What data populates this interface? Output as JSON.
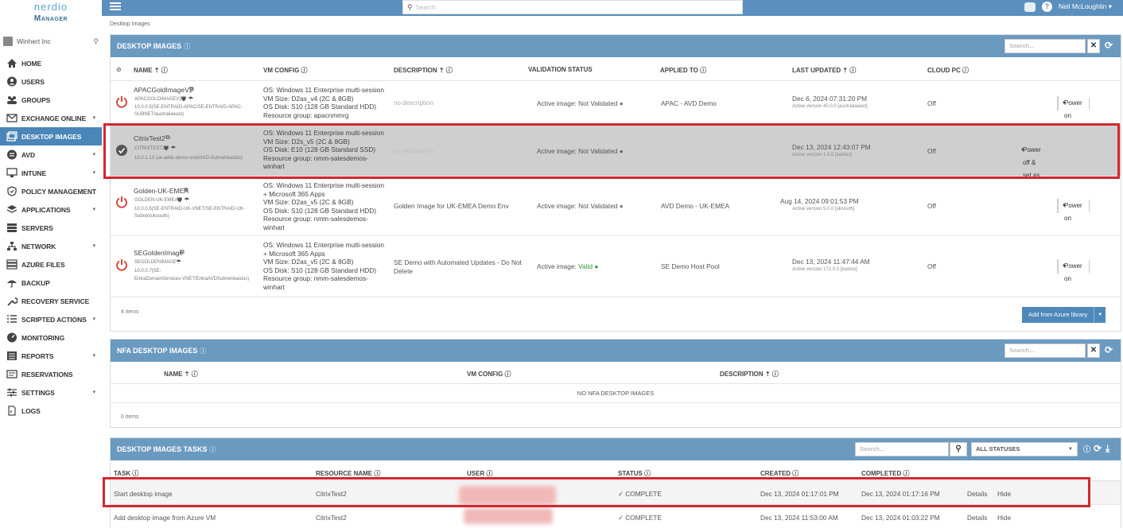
{
  "brand": {
    "logo_top": "nerdio",
    "logo_bottom": "Manager"
  },
  "org": {
    "name": "Winhert Inc"
  },
  "nav": [
    {
      "label": "HOME",
      "icon": "home-icon"
    },
    {
      "label": "USERS",
      "icon": "user-icon"
    },
    {
      "label": "GROUPS",
      "icon": "groups-icon"
    },
    {
      "label": "EXCHANGE ONLINE",
      "icon": "mail-icon",
      "chev": "▾"
    },
    {
      "label": "DESKTOP IMAGES",
      "icon": "desktop-icon",
      "active": true
    },
    {
      "label": "AVD",
      "icon": "avd-icon",
      "chev": "▾"
    },
    {
      "label": "INTUNE",
      "icon": "intune-icon",
      "chev": "▾"
    },
    {
      "label": "POLICY MANAGEMENT",
      "icon": "shield-icon",
      "chev": "▾"
    },
    {
      "label": "APPLICATIONS",
      "icon": "applications-icon",
      "chev": "▾"
    },
    {
      "label": "SERVERS",
      "icon": "servers-icon"
    },
    {
      "label": "NETWORK",
      "icon": "network-icon",
      "chev": "▾"
    },
    {
      "label": "AZURE FILES",
      "icon": "files-icon"
    },
    {
      "label": "BACKUP",
      "icon": "backup-icon"
    },
    {
      "label": "RECOVERY SERVICE",
      "icon": "wrench-icon"
    },
    {
      "label": "SCRIPTED ACTIONS",
      "icon": "script-icon",
      "chev": "▾"
    },
    {
      "label": "MONITORING",
      "icon": "monitoring-icon"
    },
    {
      "label": "REPORTS",
      "icon": "reports-icon",
      "chev": "▾"
    },
    {
      "label": "RESERVATIONS",
      "icon": "reservations-icon"
    },
    {
      "label": "SETTINGS",
      "icon": "settings-icon",
      "chev": "▾"
    },
    {
      "label": "LOGS",
      "icon": "logs-icon"
    }
  ],
  "topbar": {
    "search_placeholder": "Search",
    "user_name": "Neil McLoughlin ▾"
  },
  "breadcrumb": "Desktop Images",
  "desktop_images": {
    "title": "DESKTOP IMAGES",
    "search_placeholder": "Search...",
    "columns": {
      "name": "NAME ⇡ ⓘ",
      "vm": "VM CONFIG ⓘ",
      "desc": "DESCRIPTION ⇡ ⓘ",
      "valid": "VALIDATION STATUS",
      "applied": "APPLIED TO ⓘ",
      "updated": "LAST UPDATED ⇡ ⓘ",
      "cloud": "CLOUD PC ⓘ"
    },
    "rows": [
      {
        "name": "APACGoldImageV2",
        "sub1": "APACGOLDIMAGEV2",
        "sub2": "10.0.0.5(SE-ENTRAID-APAC/SE-ENTRAID-APAC-",
        "sub3": "SUBNET/australiaeast)",
        "vm": [
          "OS: Windows 11 Enterprise multi-session",
          "VM Size: D2as_v4 (2C & 8GB)",
          "OS Disk: S10 (128 GB Standard HDD)",
          "Resource group: apacnmmrg"
        ],
        "desc": "no description",
        "valid": "Active image: Not Validated",
        "applied": "APAC - AVD Demo",
        "updated": "Dec 6, 2024 07:31:20 PM",
        "version": "Active version 40.0.0 [australiaeast]",
        "cloud": "Off",
        "action": "Power on"
      },
      {
        "name": "CitrixTest2",
        "sub1": "CITRIXTEST2",
        "sub2": "10.0.1.13 (se-addc-demo-vnet/AVD-Subnet/eastus)",
        "sub3": "",
        "vm": [
          "OS: Windows 11 Enterprise multi-session",
          "VM Size: D2s_v5 (2C & 8GB)",
          "OS Disk: E10 (128 GB Standard SSD)",
          "Resource group: nmm-salesdemos-",
          "winhart"
        ],
        "desc": "no description",
        "valid": "Active image: Not Validated",
        "applied": "",
        "updated": "Dec 13, 2024 12:43:07 PM",
        "version": "Active version 1.0.0 [eastus]",
        "cloud": "Off",
        "action": "Power off & set as image"
      },
      {
        "name": "Golden-UK-EMEA",
        "sub1": "GOLDEN-UK-EMEA",
        "sub2": "10.0.0.5(SE-ENTRAID-UK-VNET/SE-ENTRAID-UK-",
        "sub3": "Subnet/uksouth)",
        "vm": [
          "OS: Windows 11 Enterprise multi-session",
          "+ Microsoft 365 Apps",
          "VM Size: D2as_v5 (2C & 8GB)",
          "OS Disk: S10 (128 GB Standard HDD)",
          "Resource group: nmm-salesdemos-",
          "winhart"
        ],
        "desc": "Golden Image for UK-EMEA Demo Env",
        "valid": "Active image: Not Validated",
        "applied": "AVD Demo - UK-EMEA",
        "updated": "Aug 14, 2024 09:01:53 PM",
        "version": "Active version 5.0.0 [uksouth]",
        "cloud": "Off",
        "action": "Power on"
      },
      {
        "name": "SEGoldenImage",
        "sub1": "SEGOLDENIMAGE",
        "sub2": "10.0.0.7(SE-",
        "sub3": "EntraDomainServices-VNET/EntraAVDSubnet/eastus)",
        "vm": [
          "OS: Windows 11 Enterprise multi-session",
          "+ Microsoft 365 Apps",
          "VM Size: D2as_v5 (2C & 8GB)",
          "OS Disk: S10 (128 GB Standard HDD)",
          "Resource group: nmm-salesdemos-",
          "winhart"
        ],
        "desc": "SE Demo with Automated Updates - Do Not Delete",
        "valid_prefix": "Active image: ",
        "valid": "Valid",
        "applied": "SE Demo Host Pool",
        "updated": "Dec 13, 2024 11:47:44 AM",
        "version": "Active version 172.0.0 [eastus]",
        "cloud": "Off",
        "action": "Power on"
      }
    ],
    "count": "4 items",
    "add_button": "Add from Azure library"
  },
  "nfa": {
    "title": "NFA DESKTOP IMAGES",
    "search_placeholder": "Search...",
    "columns": {
      "name": "NAME ⇡ ⓘ",
      "vm": "VM CONFIG ⓘ",
      "desc": "DESCRIPTION ⇡ ⓘ"
    },
    "empty": "NO NFA DESKTOP IMAGES",
    "count": "0 items"
  },
  "tasks": {
    "title": "DESKTOP IMAGES TASKS",
    "search_placeholder": "Search...",
    "status_filter": "ALL STATUSES",
    "columns": {
      "task": "TASK ⓘ",
      "resource": "RESOURCE NAME ⓘ",
      "user": "USER ⓘ",
      "status": "STATUS ⓘ",
      "created": "CREATED ⓘ",
      "completed": "COMPLETED ⓘ"
    },
    "rows": [
      {
        "task": "Start desktop image",
        "resource": "CitrixTest2",
        "status": "✓ COMPLETE",
        "created": "Dec 13, 2024 01:17:01 PM",
        "completed": "Dec 13, 2024 01:17:16 PM",
        "details": "Details",
        "hide": "Hide"
      },
      {
        "task": "Add desktop image from Azure VM",
        "resource": "CitrixTest2",
        "status": "✓ COMPLETE",
        "created": "Dec 13, 2024 11:53:00 AM",
        "completed": "Dec 13, 2024 01:03:22 PM",
        "details": "Details",
        "hide": "Hide"
      }
    ]
  },
  "colors": {
    "accent": "#4a86b7",
    "panel_header": "#6b9ac1",
    "highlight": "#d0282e",
    "power_red": "#d9342b",
    "valid_green": "#2f9a3a"
  }
}
